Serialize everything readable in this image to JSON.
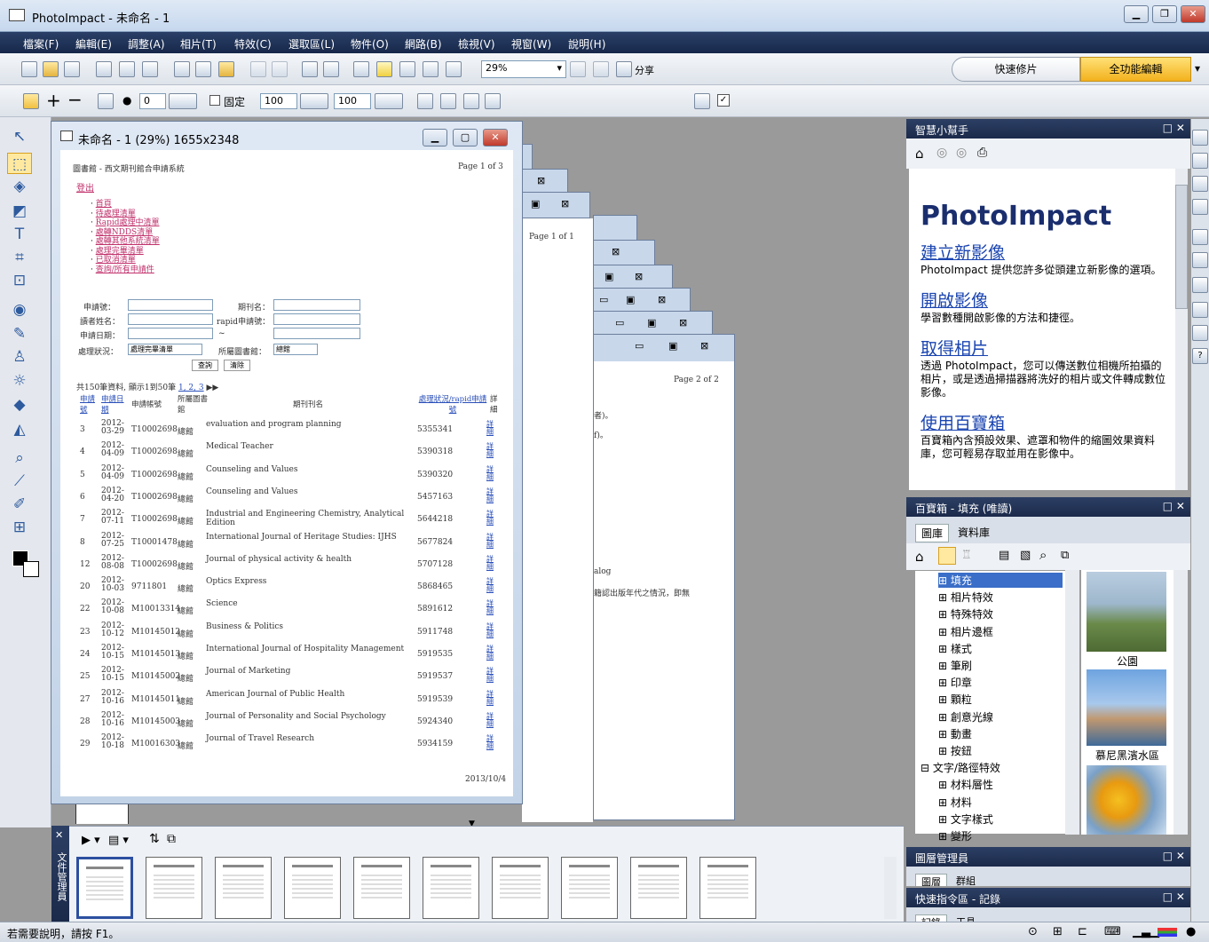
{
  "app": {
    "title": "PhotoImpact - 未命名 - 1"
  },
  "menu": [
    "檔案(F)",
    "編輯(E)",
    "調整(A)",
    "相片(T)",
    "特效(C)",
    "選取區(L)",
    "物件(O)",
    "網路(B)",
    "檢視(V)",
    "視窗(W)",
    "說明(H)"
  ],
  "toolbar": {
    "zoom": "29%",
    "share": "分享",
    "quick_fix": "快速修片",
    "full_edit": "全功能編輯"
  },
  "attrbar": {
    "value1": "0",
    "fixed_label": "固定",
    "width": "100",
    "height": "100"
  },
  "doc": {
    "title": "未命名 - 1 (29%) 1655x2348",
    "page_header": "圖書館 - 西文期刊館合申請系統",
    "page_num": "Page 1 of 3",
    "logout": "登出",
    "links": [
      "首頁",
      "待處理清單",
      "Rapid處理中清單",
      "處轉NDDS清單",
      "處轉其他系統清單",
      "處理完畢清單",
      "已取消清單",
      "查詢/所有申請件"
    ],
    "form": {
      "apply_no": "申請號：",
      "journal": "期刊名：",
      "reader": "讀者姓名：",
      "rapid_no": "rapid申請號：",
      "date": "申請日期：",
      "tilde": "~",
      "status": "處理狀況：",
      "status_val": "處理完畢清單",
      "library": "所屬圖書館：",
      "library_val": "總館",
      "query_btn": "查詢",
      "clear_btn": "清除"
    },
    "summary": "共150筆資料, 顯示1到50筆",
    "pages": "1, 2, 3",
    "columns": [
      "申請號",
      "申請日期",
      "申請帳號",
      "所屬圖書館",
      "期刊刊名",
      "處理狀況/rapid申請號",
      "詳細"
    ],
    "rows": [
      {
        "no": "3",
        "date": "2012-03-29",
        "acct": "T10002698",
        "lib": "總館",
        "journal": "evaluation and program planning",
        "rapid": "5355341"
      },
      {
        "no": "4",
        "date": "2012-04-09",
        "acct": "T10002698",
        "lib": "總館",
        "journal": "Medical Teacher",
        "rapid": "5390318"
      },
      {
        "no": "5",
        "date": "2012-04-09",
        "acct": "T10002698",
        "lib": "總館",
        "journal": "Counseling and Values",
        "rapid": "5390320"
      },
      {
        "no": "6",
        "date": "2012-04-20",
        "acct": "T10002698",
        "lib": "總館",
        "journal": "Counseling and Values",
        "rapid": "5457163"
      },
      {
        "no": "7",
        "date": "2012-07-11",
        "acct": "T10002698",
        "lib": "總館",
        "journal": "Industrial and Engineering Chemistry, Analytical Edition",
        "rapid": "5644218"
      },
      {
        "no": "8",
        "date": "2012-07-25",
        "acct": "T10001478",
        "lib": "總館",
        "journal": "International Journal of Heritage Studies: IJHS",
        "rapid": "5677824"
      },
      {
        "no": "12",
        "date": "2012-08-08",
        "acct": "T10002698",
        "lib": "總館",
        "journal": "Journal of physical activity & health",
        "rapid": "5707128"
      },
      {
        "no": "20",
        "date": "2012-10-03",
        "acct": "9711801",
        "lib": "總館",
        "journal": "Optics Express",
        "rapid": "5868465"
      },
      {
        "no": "22",
        "date": "2012-10-08",
        "acct": "M10013314",
        "lib": "總館",
        "journal": "Science",
        "rapid": "5891612"
      },
      {
        "no": "23",
        "date": "2012-10-12",
        "acct": "M10145012",
        "lib": "總館",
        "journal": "Business & Politics",
        "rapid": "5911748"
      },
      {
        "no": "24",
        "date": "2012-10-15",
        "acct": "M10145013",
        "lib": "總館",
        "journal": "International Journal of Hospitality Management",
        "rapid": "5919535"
      },
      {
        "no": "25",
        "date": "2012-10-15",
        "acct": "M10145002",
        "lib": "總館",
        "journal": "Journal of Marketing",
        "rapid": "5919537"
      },
      {
        "no": "27",
        "date": "2012-10-16",
        "acct": "M10145011",
        "lib": "總館",
        "journal": "American Journal of Public Health",
        "rapid": "5919539"
      },
      {
        "no": "28",
        "date": "2012-10-16",
        "acct": "M10145003",
        "lib": "總館",
        "journal": "Journal of Personality and Social Psychology",
        "rapid": "5924340"
      },
      {
        "no": "29",
        "date": "2012-10-18",
        "acct": "M10016303",
        "lib": "總館",
        "journal": "Journal of Travel Research",
        "rapid": "5934159"
      }
    ],
    "detail_link": "詳細",
    "footer_date": "2013/10/4"
  },
  "back_doc": {
    "page1": "Page 1 of 1",
    "page2": "Page 2 of 2",
    "frag1": "者)。",
    "frag2": "f)。",
    "frag3": "alog",
    "frag4": "籍認出版年代之情況，即無"
  },
  "smart_helper": {
    "title": "智慧小幫手",
    "heading": "PhotoImpact",
    "sections": [
      {
        "h": "建立新影像",
        "t": "PhotoImpact 提供您許多從頭建立新影像的選項。"
      },
      {
        "h": "開啟影像",
        "t": "學習數種開啟影像的方法和捷徑。"
      },
      {
        "h": "取得相片",
        "t": "透過 PhotoImpact，您可以傳送數位相機所拍攝的相片，或是透過掃描器將洗好的相片或文件轉成數位影像。"
      },
      {
        "h": "使用百寶箱",
        "t": "百寶箱內含預設效果、遮罩和物件的縮圖效果資料庫，您可輕易存取並用在影像中。"
      }
    ]
  },
  "easypalette": {
    "title": "百寶箱 - 填充 (唯讀)",
    "tabs": [
      "圖庫",
      "資料庫"
    ],
    "tree": [
      "填充",
      "相片特效",
      "特殊特效",
      "相片邊框",
      "樣式",
      "筆刷",
      "印章",
      "顆粒",
      "創意光線",
      "動畫",
      "按鈕",
      "文字/路徑特效",
      "材料層性",
      "材料",
      "文字樣式",
      "變形"
    ],
    "thumbs": [
      "公園",
      "慕尼黑濱水區"
    ]
  },
  "layer_manager": {
    "title": "圖層管理員",
    "tabs": [
      "圖層",
      "群組"
    ]
  },
  "quick_command": {
    "title": "快速指令區 - 記錄",
    "tabs": [
      "記錄",
      "工具"
    ]
  },
  "doc_manager": {
    "label": "文件管理員"
  },
  "status": {
    "text": "若需要說明，請按 F1。"
  }
}
